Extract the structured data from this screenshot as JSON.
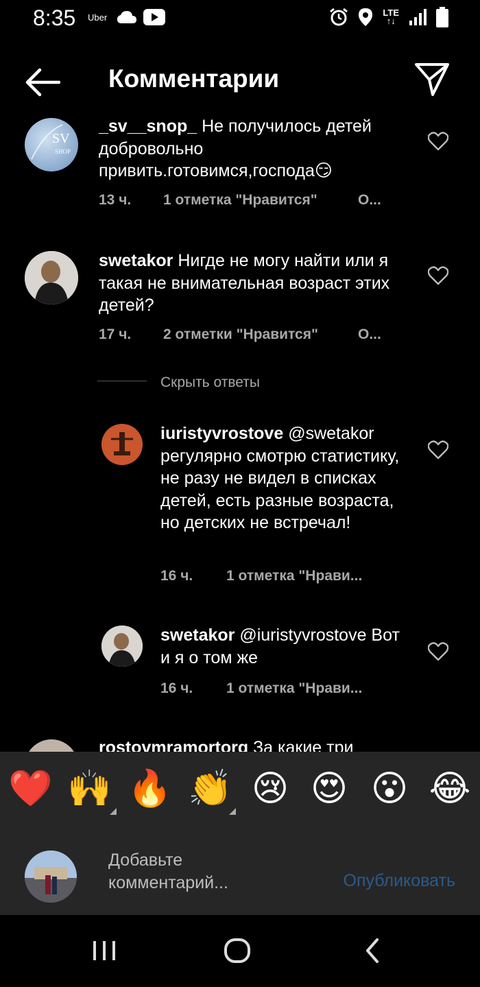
{
  "status_bar": {
    "time": "8:35",
    "uber_label": "Uber",
    "network_label": "LTE",
    "icons": [
      "cloud-icon",
      "youtube-icon",
      "alarm-icon",
      "location-icon",
      "lte-icon",
      "signal-icon",
      "battery-icon"
    ]
  },
  "header": {
    "title": "Комментарии",
    "back_icon": "back-arrow-icon",
    "share_icon": "send-icon"
  },
  "comments": [
    {
      "username": "_sv__snop_",
      "text": " Не получилось детей добровольно привить.готовимся,господа😏",
      "time": "13 ч.",
      "likes": "1 отметка \"Нравится\"",
      "reply": "О..."
    },
    {
      "username": "swetakor",
      "text": " Нигде не могу найти или я такая не внимательная возраст этих детей?",
      "time": "17 ч.",
      "likes": "2 отметки \"Нравится\"",
      "reply": "О..."
    }
  ],
  "hide_replies_label": "Скрыть ответы",
  "replies": [
    {
      "username": "iuristyvrostove",
      "text": " @swetakor регулярно смотрю статистику, не разу не видел в списках детей, есть разные возраста, но детских не встречал!",
      "time": "16 ч.",
      "likes": "1 отметка \"Нрави..."
    },
    {
      "username": "swetakor",
      "text": " @iuristyvrostove Вот и я о том же",
      "time": "16 ч.",
      "likes": "1 отметка \"Нрави..."
    }
  ],
  "partial_comment": {
    "username": "rostovmramortorg",
    "text": " За какие три"
  },
  "reactions": [
    "❤️",
    "🙌",
    "🔥",
    "👏",
    "😢",
    "😍",
    "😮",
    "😂"
  ],
  "input": {
    "placeholder": "Добавьте комментарий...",
    "publish_label": "Опубликовать"
  },
  "colors": {
    "background": "#000000",
    "panel": "#262626",
    "meta_text": "#a8a8a8",
    "publish_disabled": "#2b5a8a"
  }
}
